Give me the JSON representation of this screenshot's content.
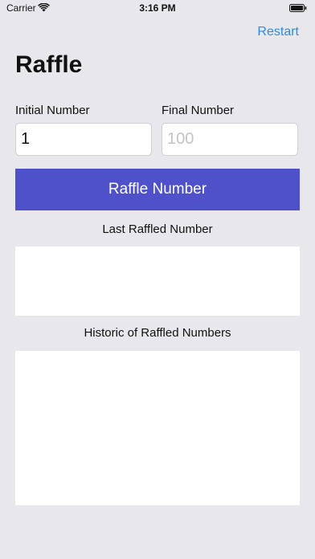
{
  "status_bar": {
    "carrier": "Carrier",
    "time": "3:16 PM",
    "wifi_icon": "wifi-icon",
    "battery_icon": "battery-icon"
  },
  "nav": {
    "restart_label": "Restart"
  },
  "page": {
    "title": "Raffle"
  },
  "form": {
    "initial_label": "Initial Number",
    "initial_value": "1",
    "final_label": "Final Number",
    "final_value": "",
    "final_placeholder": "100"
  },
  "raffle_button": {
    "label": "Raffle Number",
    "color": "#4e51c9"
  },
  "last_raffled": {
    "heading": "Last Raffled Number",
    "value": ""
  },
  "history": {
    "heading": "Historic of Raffled Numbers",
    "items": []
  },
  "colors": {
    "background": "#e8e8ec",
    "link": "#2f8ae0",
    "accent": "#4e51c9"
  }
}
